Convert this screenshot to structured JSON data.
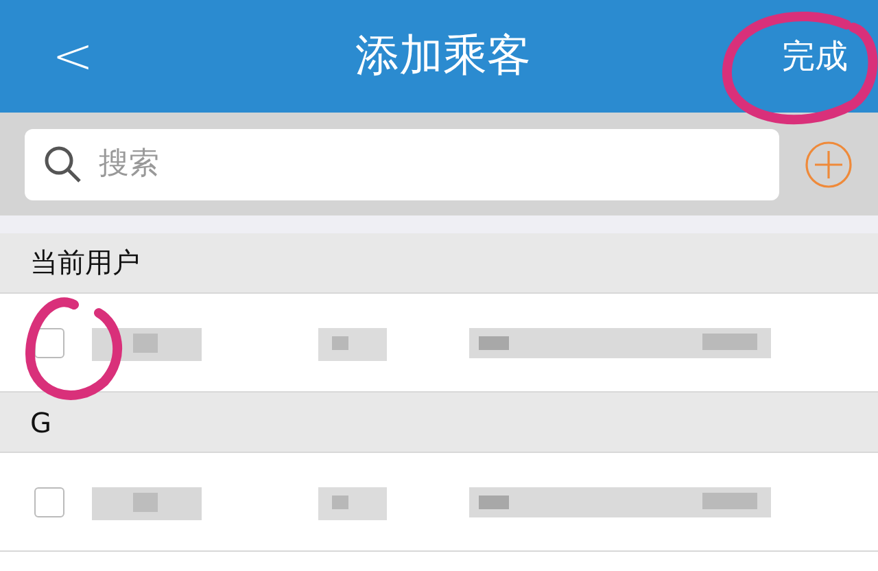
{
  "header": {
    "back": "<",
    "title": "添加乘客",
    "done": "完成"
  },
  "search": {
    "placeholder": "搜索"
  },
  "sections": [
    {
      "title": "当前用户",
      "rows": [
        {
          "checked": false
        }
      ]
    },
    {
      "title": "G",
      "rows": [
        {
          "checked": false
        }
      ]
    }
  ],
  "annotations": [
    {
      "kind": "circle"
    },
    {
      "kind": "circle"
    }
  ]
}
